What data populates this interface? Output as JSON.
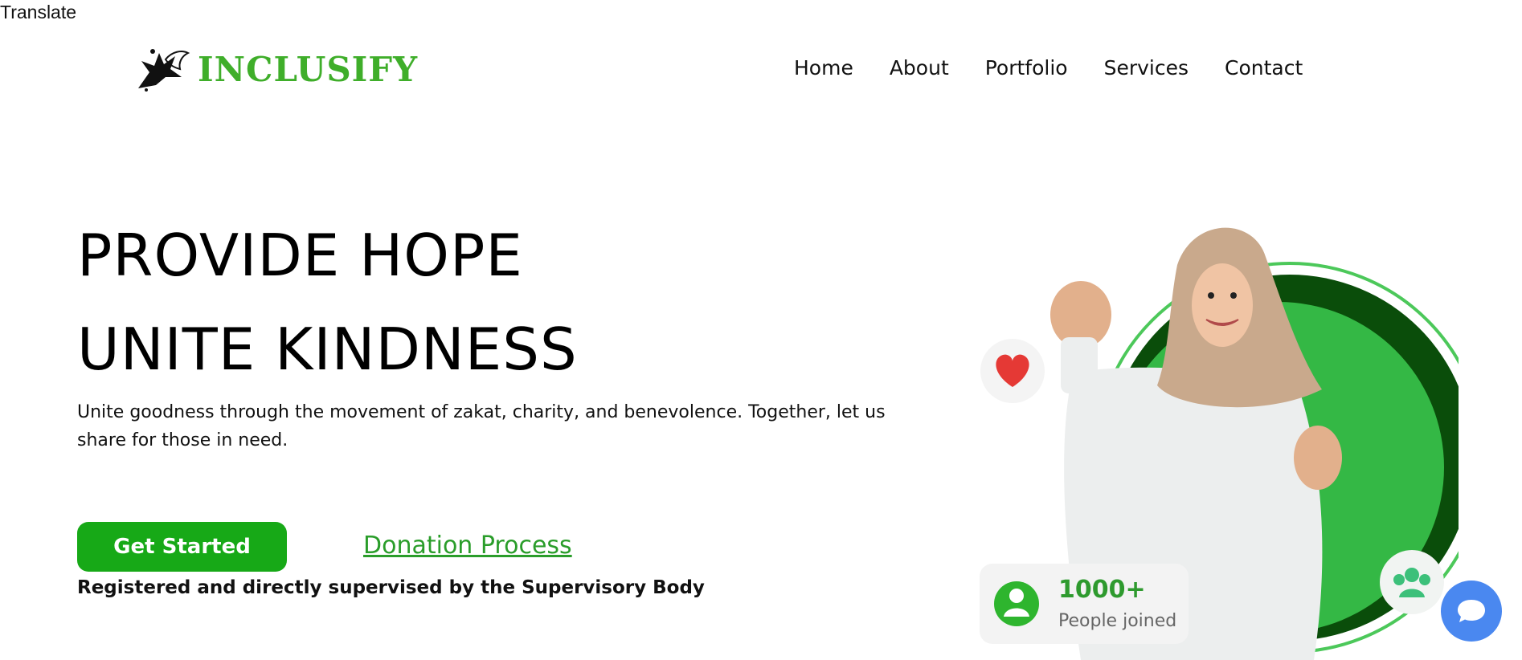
{
  "translate_label": "Translate",
  "brand": {
    "name": "INCLUSIFY",
    "icon": "hummingbird-bird-logo",
    "color": "#3fae2a"
  },
  "nav": {
    "items": [
      "Home",
      "About",
      "Portfolio",
      "Services",
      "Contact"
    ]
  },
  "hero": {
    "title_line1": "PROVIDE HOPE",
    "title_line2": "UNITE KINDNESS",
    "subtitle": "Unite goodness through the movement of zakat, charity, and benevolence. Together, let us share for those in need.",
    "cta_primary": "Get Started",
    "cta_secondary": "Donation Process",
    "registered_note": "Registered and directly supervised by the Supervisory Body"
  },
  "stats_card": {
    "value": "1000+",
    "label": "People joined",
    "icon": "user-avatar-icon"
  },
  "badges": {
    "heart": "heart-icon",
    "group": "group-people-icon"
  },
  "chat": {
    "icon": "chat-bubble-icon",
    "color": "#4a88f0"
  },
  "colors": {
    "accent_green": "#17a917",
    "dark_green": "#0a4d0a",
    "light_green": "#34b845"
  }
}
